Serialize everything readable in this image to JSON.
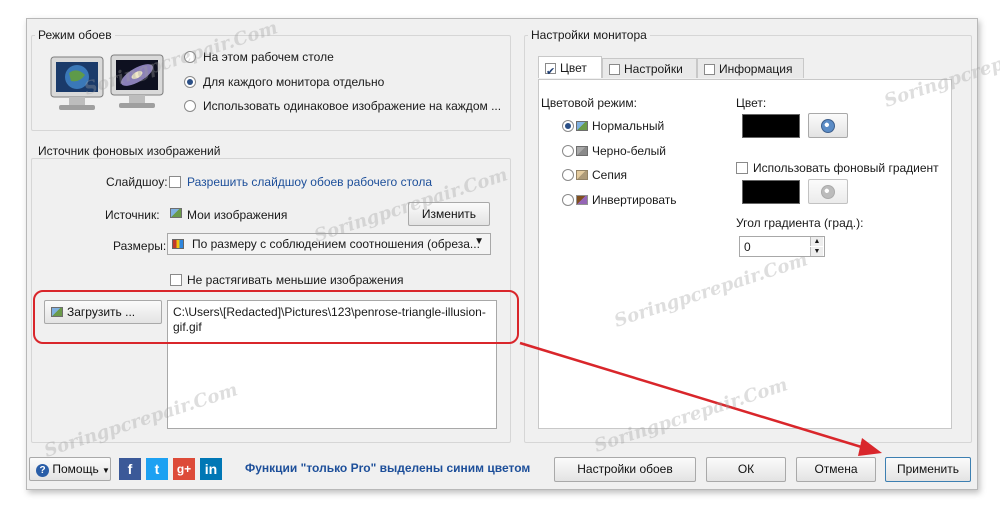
{
  "wallpaper_mode": {
    "title": "Режим обоев",
    "options": [
      "На этом рабочем столе",
      "Для каждого монитора отдельно",
      "Использовать одинаковое изображение на каждом ..."
    ],
    "selected_index": 1
  },
  "source": {
    "title": "Источник фоновых изображений",
    "slideshow_label": "Слайдшоу:",
    "slideshow_checkbox": "Разрешить слайдшоу обоев рабочего стола",
    "source_label": "Источник:",
    "source_value": "Мои изображения",
    "change_button": "Изменить",
    "sizes_label": "Размеры:",
    "sizes_value": "По размеру с соблюдением соотношения (обреза...",
    "no_stretch_label": "Не растягивать меньшие изображения",
    "load_button": "Загрузить ...",
    "path_text": "C:\\Users\\[Redacted]\\Pictures\\123\\penrose-triangle-illusion-gif.gif"
  },
  "monitor": {
    "title": "Настройки монитора",
    "tabs": [
      "Цвет",
      "Настройки",
      "Информация"
    ],
    "active_tab_index": 0,
    "color_mode_label": "Цветовой режим:",
    "color_modes": [
      "Нормальный",
      "Черно-белый",
      "Сепия",
      "Инвертировать"
    ],
    "selected_mode_index": 0,
    "color_label": "Цвет:",
    "color_value": "#000000",
    "gradient_checkbox": "Использовать фоновый градиент",
    "gradient_color_value": "#000000",
    "angle_label": "Угол градиента (град.):",
    "angle_value": "0"
  },
  "footer": {
    "help_button": "Помощь",
    "social": [
      "f",
      "t",
      "g+",
      "in"
    ],
    "pro_notice": "Функции \"только Pro\" выделены синим цветом",
    "wallpaper_settings_button": "Настройки обоев",
    "ok_button": "ОК",
    "cancel_button": "Отмена",
    "apply_button": "Применить"
  },
  "watermark_text": "Soringpcrepair.Com",
  "colors": {
    "annotation_red": "#d9262b",
    "pro_blue": "#1d4f9a",
    "brand_facebook": "#3b5998",
    "brand_twitter": "#1da1f2",
    "brand_google": "#dd4b39",
    "brand_linkedin": "#0077b5"
  }
}
